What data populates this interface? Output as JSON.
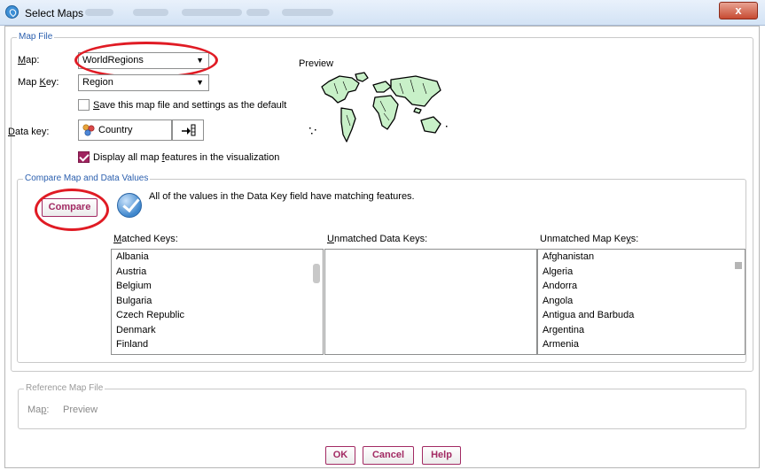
{
  "window": {
    "title": "Select Maps",
    "close_label": "x"
  },
  "map_file": {
    "legend": "Map File",
    "map_label_u": "M",
    "map_label_rest": "ap:",
    "map_value": "WorldRegions",
    "map_key_label_pre": "Map ",
    "map_key_label_u": "K",
    "map_key_label_post": "ey:",
    "map_key_value": "Region",
    "save_default_u": "S",
    "save_default_rest": "ave this map file and settings as the default",
    "save_default_checked": false,
    "data_key_label_u": "D",
    "data_key_label_rest": "ata key:",
    "data_key_value": "Country",
    "display_all_pre": "Display all map ",
    "display_all_u": "f",
    "display_all_post": "eatures in the visualization",
    "display_all_checked": true,
    "preview_label": "Preview"
  },
  "compare": {
    "legend": "Compare Map and Data Values",
    "button_label": "Compare",
    "status_message": "All of the values in the Data Key field have matching features.",
    "matched_label_u": "M",
    "matched_label_rest": "atched Keys:",
    "unmatched_data_label_u": "U",
    "unmatched_data_label_rest": "nmatched Data Keys:",
    "unmatched_map_label_pre": "Unmatched Map Ke",
    "unmatched_map_label_u": "y",
    "unmatched_map_label_post": "s:",
    "matched_keys": [
      "Albania",
      "Austria",
      "Belgium",
      "Bulgaria",
      "Czech Republic",
      "Denmark",
      "Finland"
    ],
    "unmatched_data_keys": [],
    "unmatched_map_keys": [
      "Afghanistan",
      "Algeria",
      "Andorra",
      "Angola",
      "Antigua and Barbuda",
      "Argentina",
      "Armenia"
    ]
  },
  "reference": {
    "legend": "Reference Map File",
    "map_label_pre": "Ma",
    "map_label_u": "p",
    "map_label_post": ":",
    "preview_label": "Preview"
  },
  "buttons": {
    "ok": "OK",
    "cancel": "Cancel",
    "help": "Help"
  },
  "colors": {
    "accent": "#a22a63",
    "annotation_red": "#e01b24",
    "legend_blue": "#2b5fae",
    "map_fill": "#c8f0c8"
  }
}
